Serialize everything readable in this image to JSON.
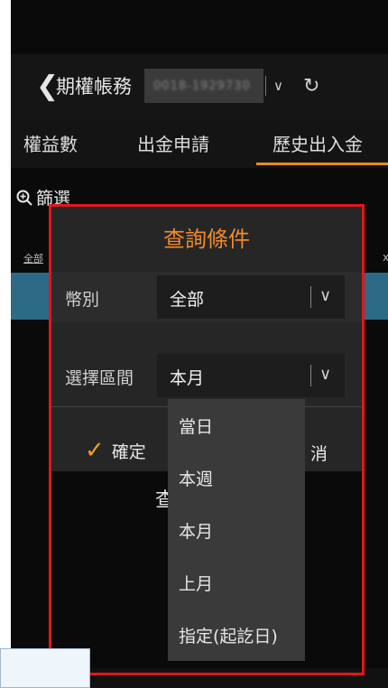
{
  "header": {
    "back_icon": "chevron-left-icon",
    "title": "期權帳務",
    "account_masked": "0018-1929730",
    "account_dropdown_icon": "chevron-down-icon",
    "refresh_icon": "refresh-icon"
  },
  "tabs": [
    {
      "label": "權益數"
    },
    {
      "label": "出金申請"
    },
    {
      "label": "歷史出入金",
      "active": true
    }
  ],
  "filter": {
    "icon": "zoom-plus-icon",
    "label": "篩選"
  },
  "background": {
    "left_label": "全部",
    "right_label": "x"
  },
  "dialog": {
    "title": "查詢條件",
    "currency": {
      "label": "幣別",
      "value": "全部"
    },
    "period": {
      "label": "選擇區間",
      "value": "本月"
    },
    "confirm": "確定",
    "cancel": "消",
    "partial_text": "查"
  },
  "dropdown": {
    "options": [
      "當日",
      "本週",
      "本月",
      "上月",
      "指定(起訖日)"
    ]
  },
  "colors": {
    "accent": "#f08a2a",
    "highlight": "#e3161c",
    "blue_bar": "#2c6a85"
  }
}
